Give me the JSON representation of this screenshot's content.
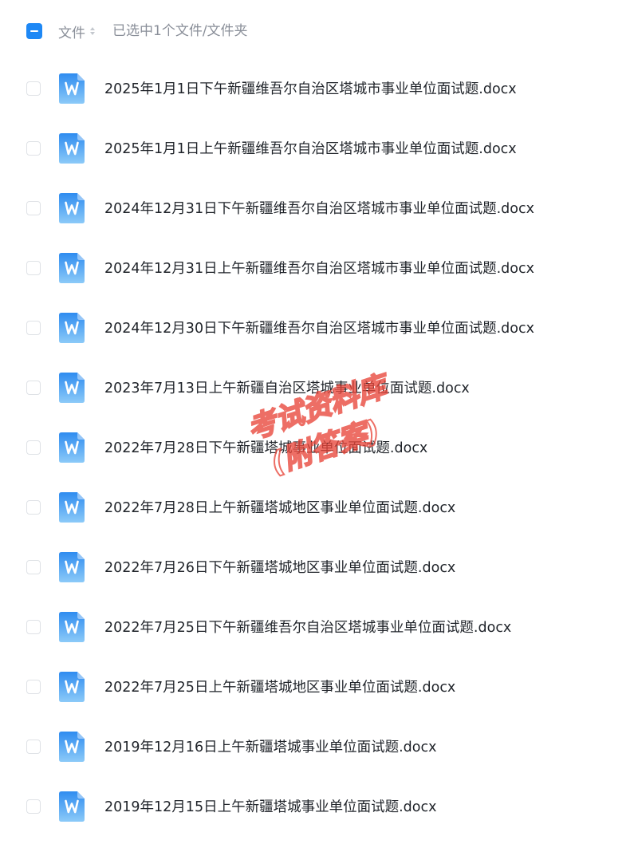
{
  "header": {
    "column_label": "文件",
    "selection_text": "已选中1个文件/文件夹",
    "select_all_state": "indeterminate"
  },
  "files": [
    {
      "name": "2025年1月1日下午新疆维吾尔自治区塔城市事业单位面试题.docx",
      "icon": "word-doc-icon",
      "selected": false
    },
    {
      "name": "2025年1月1日上午新疆维吾尔自治区塔城市事业单位面试题.docx",
      "icon": "word-doc-icon",
      "selected": false
    },
    {
      "name": "2024年12月31日下午新疆维吾尔自治区塔城市事业单位面试题.docx",
      "icon": "word-doc-icon",
      "selected": false
    },
    {
      "name": "2024年12月31日上午新疆维吾尔自治区塔城市事业单位面试题.docx",
      "icon": "word-doc-icon",
      "selected": false
    },
    {
      "name": "2024年12月30日下午新疆维吾尔自治区塔城市事业单位面试题.docx",
      "icon": "word-doc-icon",
      "selected": false
    },
    {
      "name": "2023年7月13日上午新疆自治区塔城事业单位面试题.docx",
      "icon": "word-doc-icon",
      "selected": false
    },
    {
      "name": "2022年7月28日下午新疆塔城事业单位面试题.docx",
      "icon": "word-doc-icon",
      "selected": false
    },
    {
      "name": "2022年7月28日上午新疆塔城地区事业单位面试题.docx",
      "icon": "word-doc-icon",
      "selected": false
    },
    {
      "name": "2022年7月26日下午新疆塔城地区事业单位面试题.docx",
      "icon": "word-doc-icon",
      "selected": false
    },
    {
      "name": "2022年7月25日下午新疆维吾尔自治区塔城事业单位面试题.docx",
      "icon": "word-doc-icon",
      "selected": false
    },
    {
      "name": "2022年7月25日上午新疆塔城地区事业单位面试题.docx",
      "icon": "word-doc-icon",
      "selected": false
    },
    {
      "name": "2019年12月16日上午新疆塔城事业单位面试题.docx",
      "icon": "word-doc-icon",
      "selected": false
    },
    {
      "name": "2019年12月15日上午新疆塔城事业单位面试题.docx",
      "icon": "word-doc-icon",
      "selected": false
    }
  ],
  "watermark": {
    "line1": "考试资料库",
    "line2": "(附答案)",
    "color": "#e8463a"
  },
  "colors": {
    "accent": "#1e88f5",
    "doc_icon_top": "#2f8cf0",
    "doc_icon_bottom": "#8ccaf8",
    "text_primary": "#1f2329",
    "text_secondary": "#8a8f99"
  }
}
